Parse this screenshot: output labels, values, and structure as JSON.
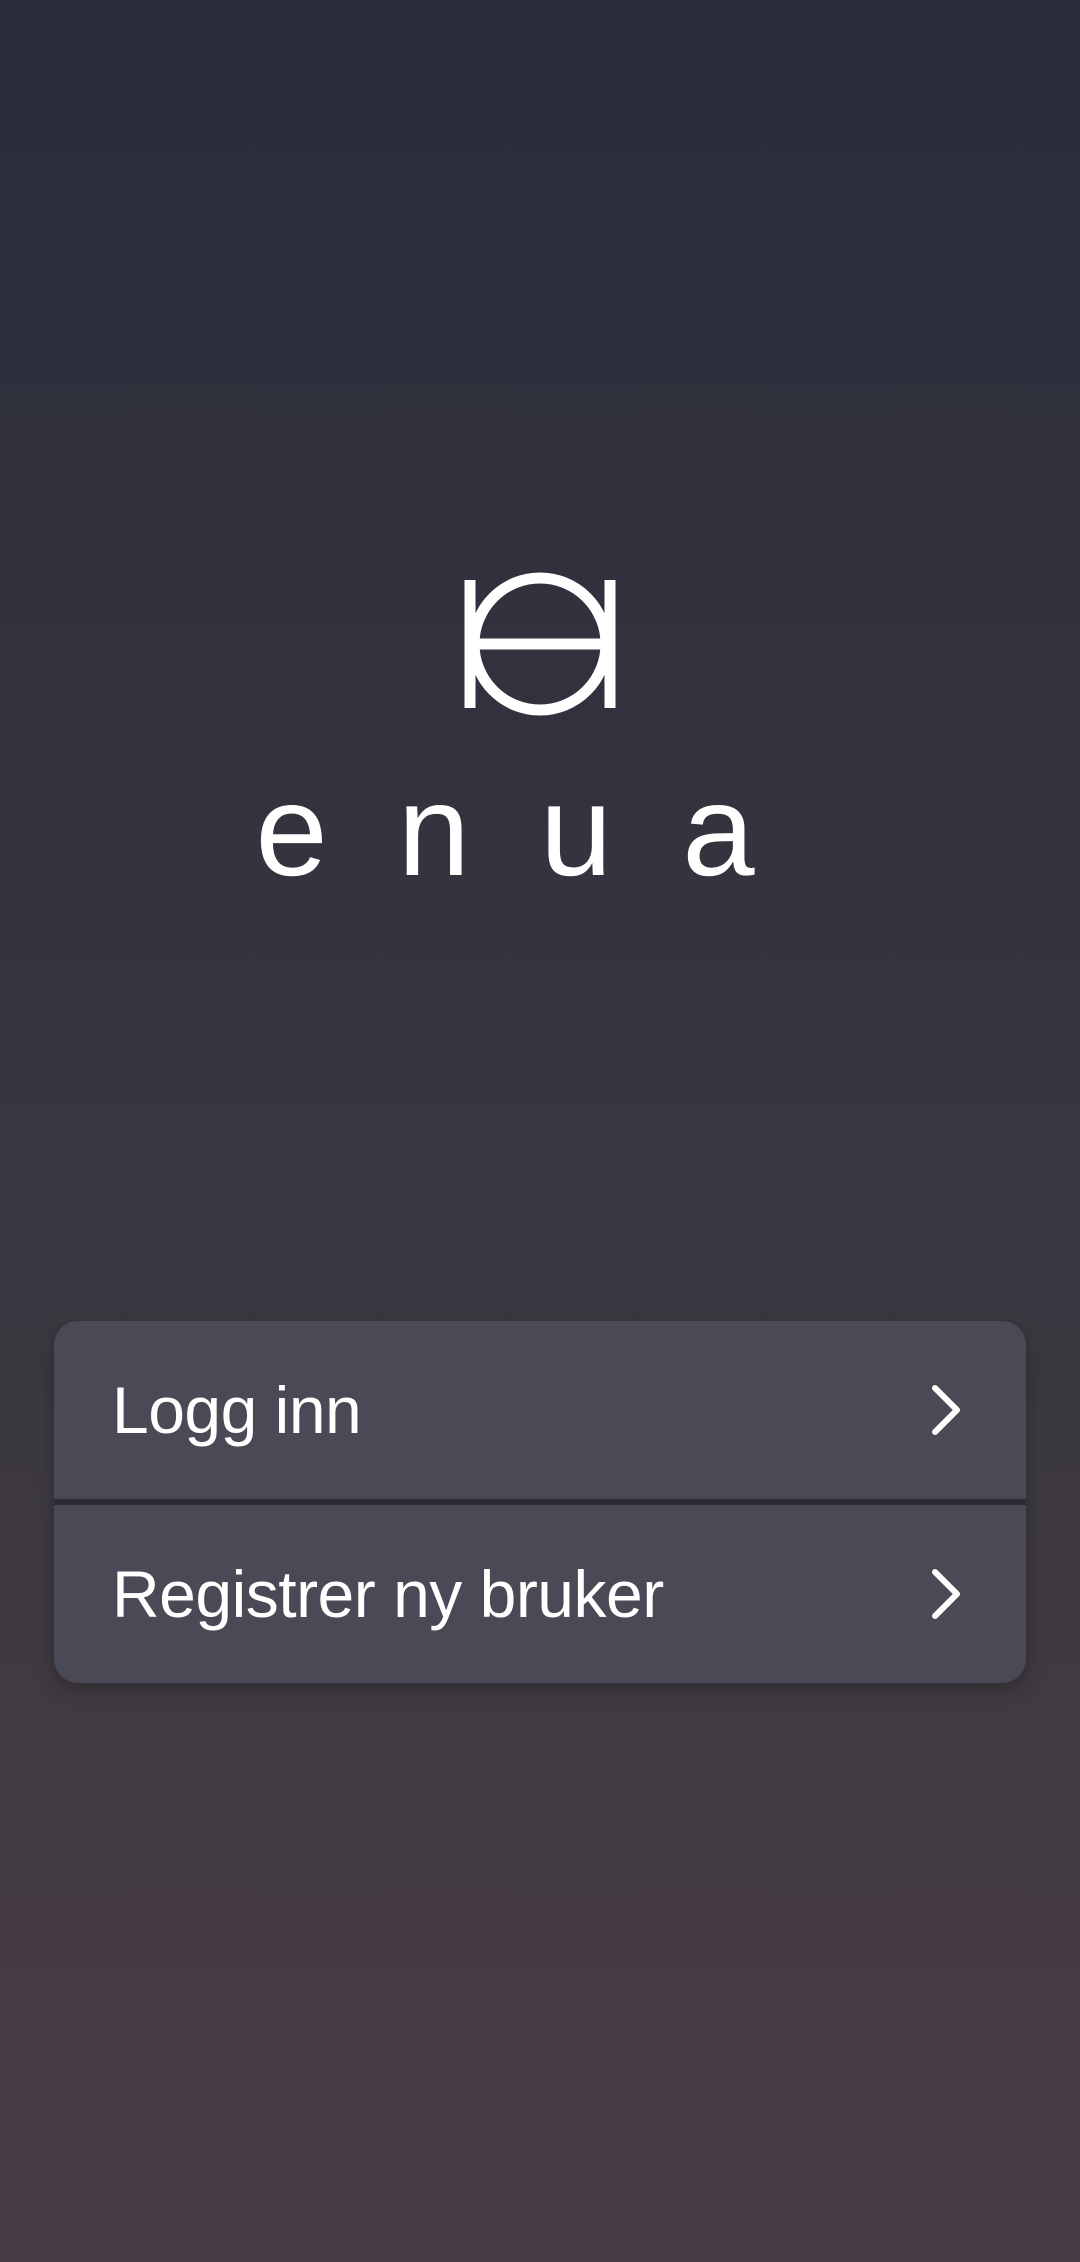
{
  "brand": {
    "logo_icon": "enua-logo-icon",
    "wordmark": "enua"
  },
  "menu": {
    "items": [
      {
        "label": "Logg inn",
        "icon": "chevron-right-icon"
      },
      {
        "label": "Registrer ny bruker",
        "icon": "chevron-right-icon"
      }
    ]
  },
  "colors": {
    "background_top": "#2a2c3a",
    "background_bottom": "#483c44",
    "card": "#4a4a57",
    "text": "#ffffff"
  }
}
